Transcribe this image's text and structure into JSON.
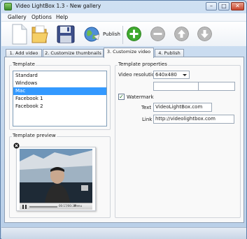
{
  "window": {
    "title": "Video LightBox 1.3  - New gallery",
    "minimize_symbol": "–",
    "maximize_symbol": "□",
    "close_symbol": "✕"
  },
  "menu": {
    "items": [
      "Gallery",
      "Options",
      "Help"
    ]
  },
  "toolbar": {
    "publish_label": "Publish",
    "icons": [
      "new-file-icon",
      "open-folder-icon",
      "save-floppy-icon",
      "publish-globe-icon",
      "add-green-icon",
      "remove-grey-icon",
      "move-up-icon",
      "move-down-icon"
    ]
  },
  "tabs": [
    {
      "label": "1. Add video",
      "active": false
    },
    {
      "label": "2. Customize thumbnails",
      "active": false
    },
    {
      "label": "3. Customize video",
      "active": true
    },
    {
      "label": "4. Publish",
      "active": false
    }
  ],
  "template": {
    "group_label": "Template",
    "items": [
      "Standard",
      "Windows",
      "Mac",
      "Facebook 1",
      "Facebook 2"
    ],
    "selected": "Mac"
  },
  "template_preview": {
    "group_label": "Template preview",
    "controls_time": "00:17/00:30",
    "controls_label": "Menu"
  },
  "template_properties": {
    "group_label": "Template properties",
    "video_resolution_label": "Video resolution",
    "video_resolution_value": "640x480",
    "width_value": "",
    "height_value": "",
    "size_separator": "x",
    "watermark_label": "Watermark",
    "watermark_checked": true,
    "text_label": "Text",
    "text_value": "VideoLightBox.com",
    "link_label": "Link",
    "link_value": "http://videolightbox.com"
  },
  "colors": {
    "selection": "#3399ff",
    "add_button": "#3faa2e",
    "disabled_button": "#b9b9b9"
  }
}
